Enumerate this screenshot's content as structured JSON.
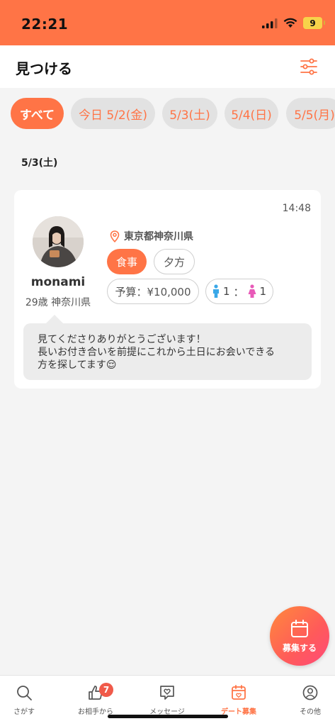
{
  "status_bar": {
    "time": "22:21",
    "battery": "9"
  },
  "header": {
    "title": "見つける"
  },
  "date_chips": [
    {
      "label": "すべて",
      "active": true
    },
    {
      "label": "今日 5/2(金)",
      "active": false
    },
    {
      "label": "5/3(土)",
      "active": false
    },
    {
      "label": "5/4(日)",
      "active": false
    },
    {
      "label": "5/5(月)",
      "active": false
    }
  ],
  "section": {
    "date": "5/3(土)"
  },
  "post": {
    "time": "14:48",
    "username": "monami",
    "user_meta": "29歳 神奈川県",
    "location": "東京都神奈川県",
    "tags": [
      "食事",
      "夕方"
    ],
    "budget": "予算：¥10,000",
    "male_count": "1",
    "separator": "：",
    "female_count": "1",
    "message_lines": [
      "見てくださりありがとうございます！",
      "長いお付き合いを前提にこれから土日にお会いできる",
      "方を探してます😌"
    ]
  },
  "fab": {
    "label": "募集する"
  },
  "nav": [
    {
      "label": "さがす",
      "icon": "search-icon"
    },
    {
      "label": "お相手から",
      "icon": "thumbs-up-icon",
      "badge": "7"
    },
    {
      "label": "メッセージ",
      "icon": "message-heart-icon"
    },
    {
      "label": "デート募集",
      "icon": "calendar-heart-icon",
      "active": true
    },
    {
      "label": "その他",
      "icon": "profile-icon"
    }
  ],
  "colors": {
    "accent": "#ff7446",
    "badge": "#f05a4a"
  }
}
